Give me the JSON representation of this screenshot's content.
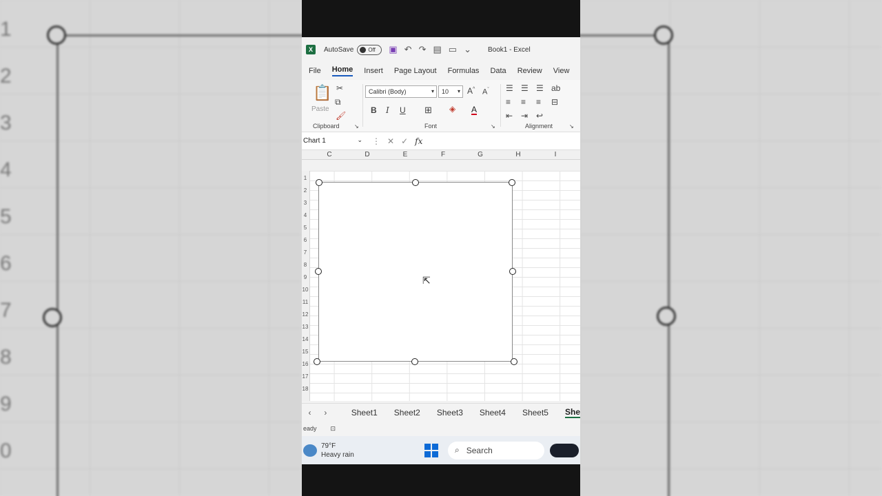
{
  "titlebar": {
    "autosave_label": "AutoSave",
    "autosave_state": "Off",
    "document_title": "Book1 - Excel"
  },
  "ribbon_tabs": [
    "File",
    "Home",
    "Insert",
    "Page Layout",
    "Formulas",
    "Data",
    "Review",
    "View"
  ],
  "active_tab": "Home",
  "ribbon": {
    "clipboard": {
      "paste_label": "Paste",
      "group_label": "Clipboard"
    },
    "font": {
      "font_name": "Calibri (Body)",
      "font_size": "10",
      "group_label": "Font"
    },
    "alignment": {
      "group_label": "Alignment"
    }
  },
  "formula_bar": {
    "name_box": "Chart 1",
    "fx": "fx"
  },
  "columns": [
    "C",
    "D",
    "E",
    "F",
    "G",
    "H",
    "I"
  ],
  "row_numbers": [
    "1",
    "2",
    "3",
    "4",
    "5",
    "6",
    "7",
    "8",
    "9",
    "10",
    "11",
    "12",
    "13",
    "14",
    "15",
    "16",
    "17",
    "18"
  ],
  "sheet_tabs": [
    "Sheet1",
    "Sheet2",
    "Sheet3",
    "Sheet4",
    "Sheet5",
    "She"
  ],
  "status": {
    "mode": "eady"
  },
  "taskbar": {
    "temperature": "79°F",
    "weather": "Heavy rain",
    "search_label": "Search"
  },
  "accent_colors": {
    "excel_green": "#1d6f42",
    "home_tab_underline": "#185abd",
    "windows_blue": "#0d6ad6"
  }
}
